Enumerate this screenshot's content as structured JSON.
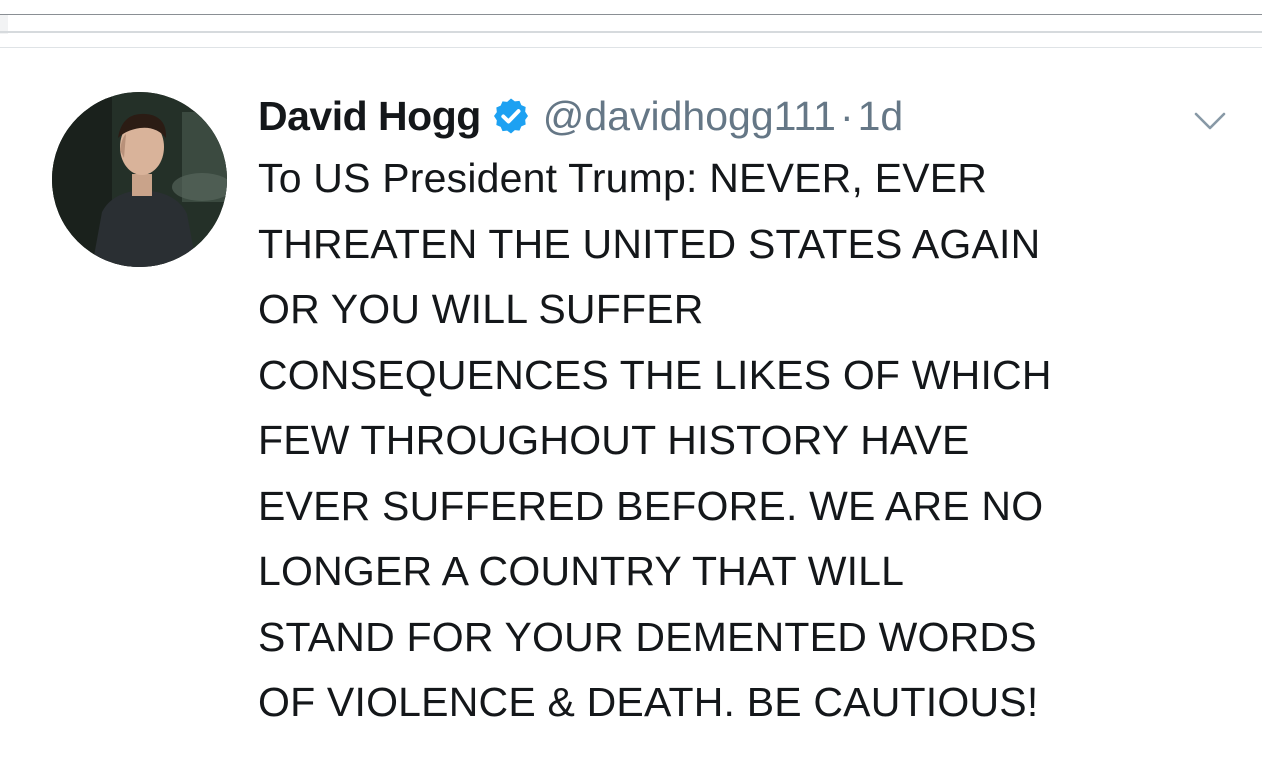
{
  "tweet": {
    "display_name": "David Hogg",
    "handle": "@davidhogg111",
    "separator": "·",
    "timestamp": "1d",
    "verified": true,
    "text_lines": [
      "To US President Trump: NEVER, EVER",
      "THREATEN THE UNITED STATES AGAIN",
      "OR YOU WILL SUFFER",
      "CONSEQUENCES THE LIKES OF WHICH",
      "FEW THROUGHOUT HISTORY HAVE",
      "EVER SUFFERED BEFORE. WE ARE NO",
      "LONGER A COUNTRY THAT WILL",
      "STAND FOR YOUR DEMENTED WORDS",
      "OF VIOLENCE & DEATH. BE CAUTIOUS!"
    ]
  },
  "icons": {
    "verified": "verified-badge-icon",
    "menu": "chevron-down-icon"
  },
  "colors": {
    "text": "#14171a",
    "secondary": "#657786",
    "verified_blue": "#1da1f2"
  }
}
